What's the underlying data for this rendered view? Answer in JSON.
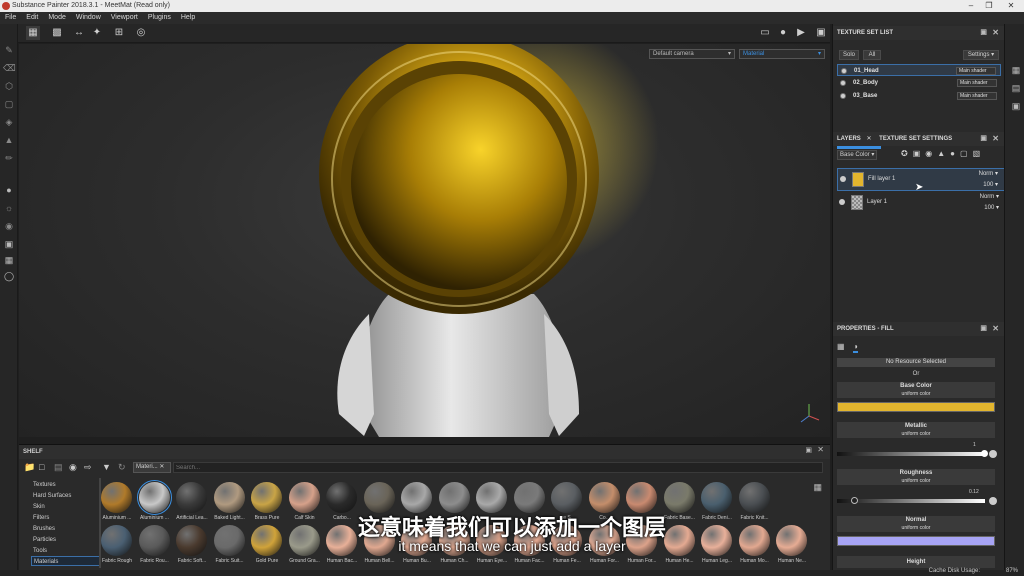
{
  "window": {
    "title": "Substance Painter 2018.3.1 - MeetMat (Read only)"
  },
  "menu": [
    "File",
    "Edit",
    "Mode",
    "Window",
    "Viewport",
    "Plugins",
    "Help"
  ],
  "viewport": {
    "camera": "Default camera",
    "mode": "Material"
  },
  "texture_set_list": {
    "title": "TEXTURE SET LIST",
    "solo": "Solo",
    "all": "All",
    "settings": "Settings",
    "sets": [
      {
        "name": "01_Head",
        "shader": "Main shader"
      },
      {
        "name": "02_Body",
        "shader": "Main shader"
      },
      {
        "name": "03_Base",
        "shader": "Main shader"
      }
    ]
  },
  "layers": {
    "tab": "LAYERS",
    "tab2": "TEXTURE SET SETTINGS",
    "channel": "Base Color",
    "items": [
      {
        "name": "Fill layer 1",
        "blend": "Norm",
        "opacity": "100"
      },
      {
        "name": "Layer 1",
        "blend": "Norm",
        "opacity": "100"
      }
    ]
  },
  "properties": {
    "title": "PROPERTIES - FILL",
    "no_resource": "No Resource Selected",
    "or": "Or",
    "base_color": "Base Color",
    "metallic": "Metallic",
    "roughness": "Roughness",
    "normal": "Normal",
    "height": "Height",
    "uniform": "uniform color",
    "metallic_value": "1",
    "roughness_value": "0.12",
    "colors": {
      "base": "#e2b52e",
      "normal": "#a7a4f5"
    }
  },
  "shelf": {
    "title": "SHELF",
    "filter_tag": "Materi...",
    "search_placeholder": "Search...",
    "categories": [
      "Textures",
      "Hard Surfaces",
      "Skin",
      "Filters",
      "Brushes",
      "Particles",
      "Tools",
      "Materials"
    ],
    "row1": [
      "Aluminium ...",
      "Aluminium ...",
      "Artificial Lea...",
      "Baked Light...",
      "Brass Pure",
      "Calf Skin",
      "Carbo...",
      "",
      "",
      "",
      "",
      "",
      "...e S...",
      "Co...",
      "",
      "Fabric Base...",
      "Fabric Deni...",
      "Fabric Knit..."
    ],
    "row2": [
      "Fabric Rough",
      "Fabric Rou...",
      "Fabric Soft...",
      "Fabric Suit...",
      "Gold Pure",
      "Ground Gra...",
      "Human Bac...",
      "Human Bell...",
      "Human Bu...",
      "Human Ch...",
      "Human Eye...",
      "Human Fac...",
      "Human Fe...",
      "Human For...",
      "Human For...",
      "Human He...",
      "Human Leg...",
      "Human Mo...",
      "Human Ne..."
    ]
  },
  "status": {
    "cache_label": "Cache Disk Usage:",
    "cache_value": "87%"
  },
  "subtitles": {
    "cn": "这意味着我们可以添加一个图层",
    "en": "it means that we can just add a layer"
  }
}
